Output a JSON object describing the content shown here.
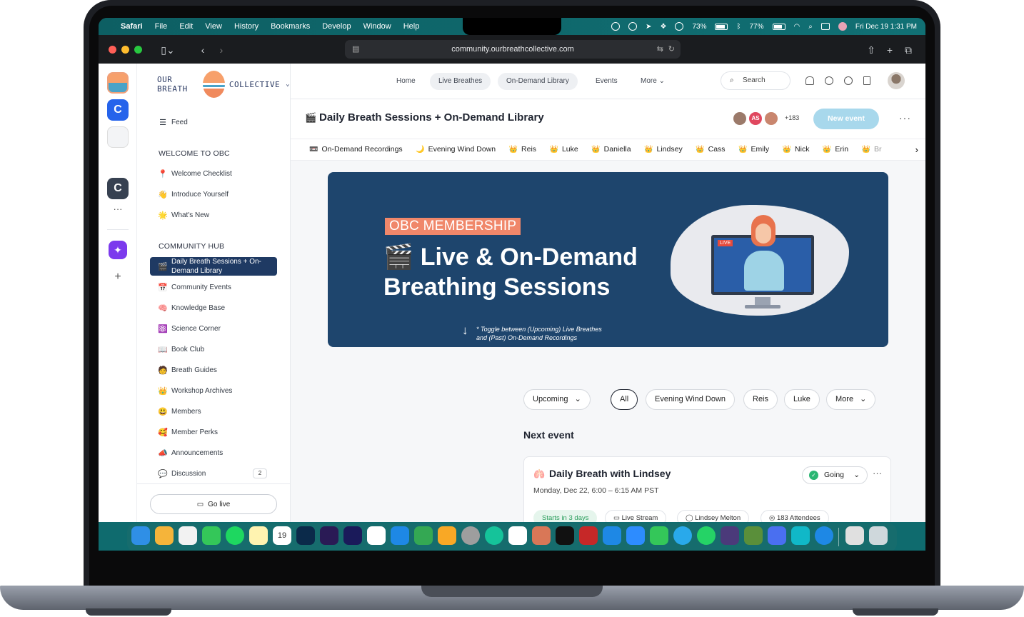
{
  "menubar": {
    "apple": "",
    "items": [
      "Safari",
      "File",
      "Edit",
      "View",
      "History",
      "Bookmarks",
      "Develop",
      "Window",
      "Help"
    ],
    "battery1": "73%",
    "battery2": "77%",
    "clock": "Fri Dec 19  1:31 PM"
  },
  "browser": {
    "url": "community.ourbreathcollective.com"
  },
  "brand": {
    "left": "OUR BREATH",
    "right": "COLLECTIVE"
  },
  "topnav": {
    "items": [
      "Home",
      "Live Breathes",
      "On-Demand Library",
      "Events",
      "More"
    ],
    "search": "Search"
  },
  "sidebar": {
    "feed": {
      "emoji": "☰",
      "label": "Feed"
    },
    "welcome_heading": "WELCOME TO OBC",
    "welcome": [
      {
        "emoji": "📍",
        "label": "Welcome Checklist"
      },
      {
        "emoji": "👋",
        "label": "Introduce Yourself"
      },
      {
        "emoji": "🌟",
        "label": "What's New"
      }
    ],
    "hub_heading": "COMMUNITY HUB",
    "hub": [
      {
        "emoji": "🎬",
        "label": "Daily Breath Sessions + On-Demand Library"
      },
      {
        "emoji": "📅",
        "label": "Community Events"
      },
      {
        "emoji": "🧠",
        "label": "Knowledge Base"
      },
      {
        "emoji": "⚛️",
        "label": "Science Corner"
      },
      {
        "emoji": "📖",
        "label": "Book Club"
      },
      {
        "emoji": "🧑",
        "label": "Breath Guides"
      },
      {
        "emoji": "👑",
        "label": "Workshop Archives"
      },
      {
        "emoji": "😃",
        "label": "Members"
      },
      {
        "emoji": "🥰",
        "label": "Member Perks"
      },
      {
        "emoji": "📣",
        "label": "Announcements"
      },
      {
        "emoji": "💬",
        "label": "Discussion",
        "badge": "2"
      }
    ],
    "go_live": "Go live"
  },
  "space": {
    "emoji": "🎬",
    "title": "Daily Breath Sessions + On-Demand Library",
    "avatar_initials": "AS",
    "member_count": "+183",
    "new_event": "New event",
    "more": "···"
  },
  "strip": [
    {
      "emoji": "📼",
      "label": "On-Demand Recordings"
    },
    {
      "emoji": "🌙",
      "label": "Evening Wind Down"
    },
    {
      "emoji": "👑",
      "label": "Reis"
    },
    {
      "emoji": "👑",
      "label": "Luke"
    },
    {
      "emoji": "👑",
      "label": "Daniella"
    },
    {
      "emoji": "👑",
      "label": "Lindsey"
    },
    {
      "emoji": "👑",
      "label": "Cass"
    },
    {
      "emoji": "👑",
      "label": "Emily"
    },
    {
      "emoji": "👑",
      "label": "Nick"
    },
    {
      "emoji": "👑",
      "label": "Erin"
    },
    {
      "emoji": "👑",
      "label": "Br"
    }
  ],
  "banner": {
    "tag": "OBC MEMBERSHIP",
    "title_line1": "🎬 Live & On-Demand",
    "title_line2": "Breathing Sessions",
    "note_line1": "* Toggle between (Upcoming) Live Breathes",
    "note_line2": "and (Past) On-Demand Recordings",
    "live_badge": "LIVE"
  },
  "filters": {
    "upcoming": "Upcoming",
    "chips": [
      "All",
      "Evening Wind Down",
      "Reis",
      "Luke"
    ],
    "more": "More"
  },
  "next_event": {
    "heading": "Next event",
    "emoji": "🫁",
    "title": "Daily Breath with Lindsey",
    "datetime": "Monday, Dec 22, 6:00 – 6:15 AM PST",
    "rsvp": "Going",
    "tags": [
      "Starts in 3 days",
      "Live Stream",
      "Lindsey Melton",
      "183 Attendees"
    ]
  },
  "colors": {
    "accent": "#1f3a63",
    "new_event": "#a8d8ec",
    "banner": "#1e456d",
    "tag": "#f0876a",
    "going": "#2bb673"
  }
}
